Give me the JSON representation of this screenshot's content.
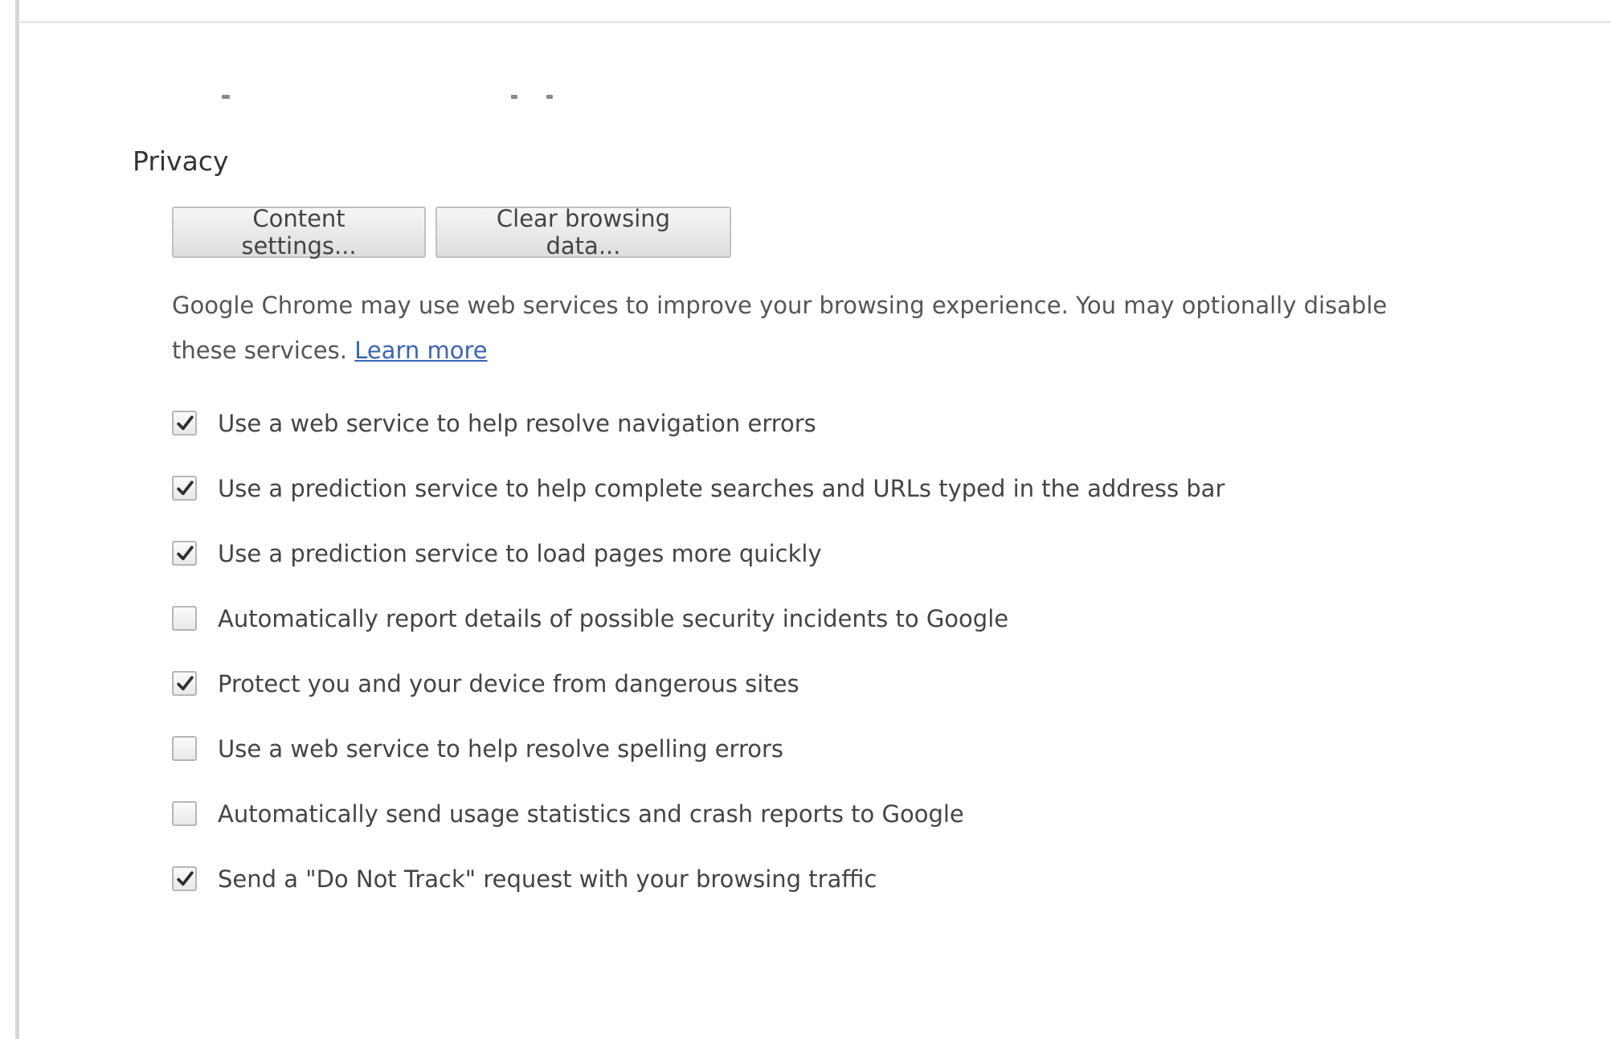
{
  "privacy": {
    "title": "Privacy",
    "buttons": {
      "content_settings": "Content settings...",
      "clear_browsing_data": "Clear browsing data..."
    },
    "description": "Google Chrome may use web services to improve your browsing experience. You may optionally disable these services.",
    "learn_more": "Learn more",
    "options": [
      {
        "label": "Use a web service to help resolve navigation errors",
        "checked": true
      },
      {
        "label": "Use a prediction service to help complete searches and URLs typed in the address bar",
        "checked": true
      },
      {
        "label": "Use a prediction service to load pages more quickly",
        "checked": true
      },
      {
        "label": "Automatically report details of possible security incidents to Google",
        "checked": false
      },
      {
        "label": "Protect you and your device from dangerous sites",
        "checked": true
      },
      {
        "label": "Use a web service to help resolve spelling errors",
        "checked": false
      },
      {
        "label": "Automatically send usage statistics and crash reports to Google",
        "checked": false
      },
      {
        "label": "Send a \"Do Not Track\" request with your browsing traffic",
        "checked": true
      }
    ]
  },
  "icons": {
    "checkmark": "checkmark-icon"
  },
  "colors": {
    "link": "#3a65b8",
    "text": "#444444",
    "checkbox_border": "#b6b6b6"
  }
}
